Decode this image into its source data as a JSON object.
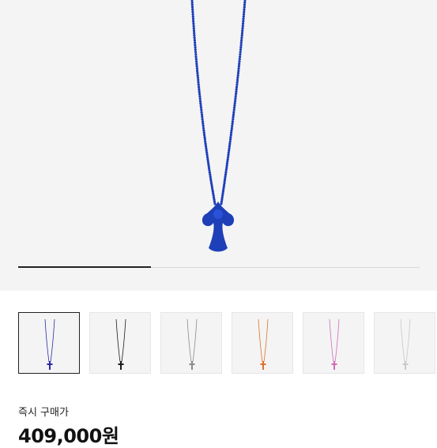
{
  "product_image": {
    "alt": "blue-cross-pendant-necklace",
    "color": "#1d3fb8"
  },
  "carousel": {
    "slide_progress": 0.33
  },
  "thumbnails": [
    {
      "name": "thumb-blue",
      "color": "#2a2aa8",
      "selected": true
    },
    {
      "name": "thumb-black",
      "color": "#1a1a1a",
      "selected": false
    },
    {
      "name": "thumb-silver",
      "color": "#8a8a8a",
      "selected": false
    },
    {
      "name": "thumb-orange",
      "color": "#e0702a",
      "selected": false
    },
    {
      "name": "thumb-pink",
      "color": "#d06ab8",
      "selected": false
    },
    {
      "name": "thumb-white",
      "color": "#c8c8c8",
      "selected": false
    }
  ],
  "purchase": {
    "label": "즉시 구매가",
    "price": "409,000원"
  }
}
